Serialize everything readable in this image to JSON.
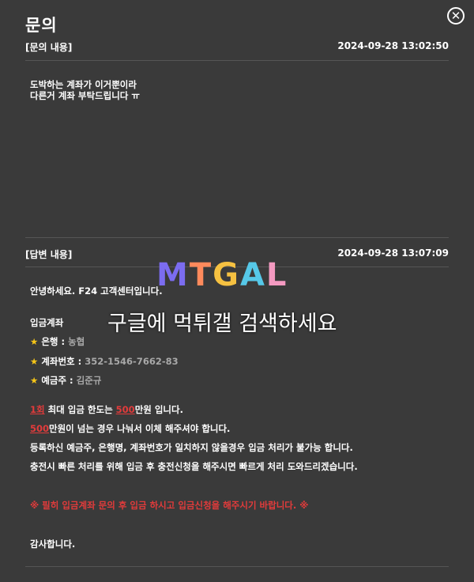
{
  "header": {
    "title": "문의",
    "close_icon": "close-icon"
  },
  "question": {
    "label": "[문의 내용]",
    "timestamp": "2024-09-28 13:02:50",
    "lines": [
      "도박하는 계좌가 이거뿐이라",
      "다른거 계좌 부탁드립니다 ㅠ"
    ]
  },
  "answer": {
    "label": "[답변 내용]",
    "timestamp": "2024-09-28 13:07:09",
    "greeting": "안녕하세요. F24 고객센터입니다.",
    "deposit_title": "입금계좌",
    "bank_label": "은행 :",
    "bank_value": "농협",
    "account_label": "계좌번호 :",
    "account_value": "352-1546-7662-83",
    "holder_label": "예금주 :",
    "holder_value": "김준규",
    "limit_count": "1회",
    "limit_mid": " 최대 입금 한도는 ",
    "limit_amount": "500",
    "limit_end": "만원 입니다.",
    "over_amount": "500",
    "over_end": "만원이 넘는 경우 나눠서 이체 해주셔야 합니다.",
    "rule_mismatch": "등록하신 예금주, 은행명, 계좌번호가 일치하지 않을경우 입금 처리가 불가능 합니다.",
    "rule_fast": "충전시 빠른 처리를 위해 입금 후 충전신청을 해주시면 빠르게 처리 도와드리겠습니다.",
    "notice": "※ 필히 입금계좌 문의 후 입금 하시고 입금신청을 해주시기 바랍니다. ※",
    "thanks": "감사합니다."
  },
  "watermark": {
    "logo_m": "M",
    "logo_t": "T",
    "logo_g": "G",
    "logo_a": "A",
    "logo_l": "L",
    "text": "구글에 먹튀갤 검색하세요"
  },
  "colors": {
    "background": "#3a3a3a",
    "accent_red": "#e23b3b",
    "star": "#f5c518"
  }
}
